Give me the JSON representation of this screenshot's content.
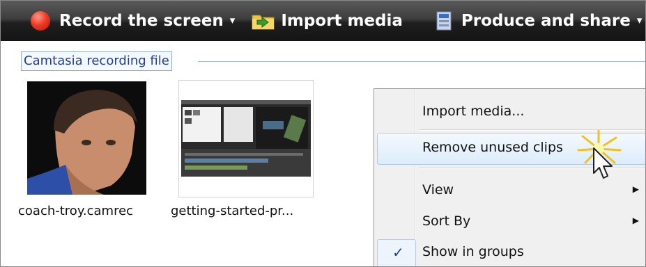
{
  "toolbar": {
    "record_label": "Record the screen",
    "import_label": "Import media",
    "produce_label": "Produce and share",
    "caret": "▾"
  },
  "group": {
    "title": "Camtasia recording file"
  },
  "clips": [
    {
      "name": "coach-troy.camrec"
    },
    {
      "name": "getting-started-pr..."
    }
  ],
  "context_menu": {
    "items": [
      {
        "label": "Import media..."
      },
      {
        "label": "Remove unused clips"
      },
      {
        "label": "View",
        "submenu": "▶"
      },
      {
        "label": "Sort By",
        "submenu": "▶"
      },
      {
        "label": "Show in groups",
        "check": "✓"
      }
    ]
  },
  "colors": {
    "toolbar_top": "#5a5a5a",
    "toolbar_bottom": "#141414",
    "record_red": "#ef3b25",
    "group_text": "#1e3e9a",
    "highlight_border": "#aacbea"
  },
  "icons": [
    "record-icon",
    "folder-import-icon",
    "produce-icon",
    "chevron-down-icon",
    "submenu-arrow-icon",
    "checkmark-icon",
    "mouse-cursor-icon",
    "click-spark-icon"
  ]
}
